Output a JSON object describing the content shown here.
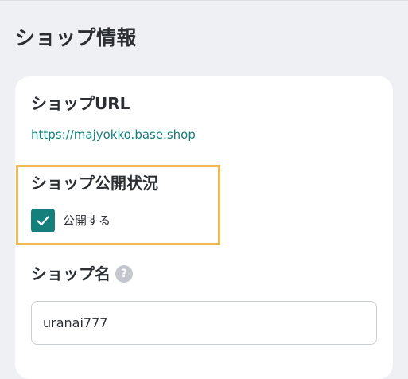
{
  "page": {
    "title": "ショップ情報"
  },
  "shop_url": {
    "label": "ショップURL",
    "value": "https://majyokko.base.shop"
  },
  "publish_status": {
    "label": "ショップ公開状況",
    "checkbox_label": "公開する",
    "checked": true
  },
  "shop_name": {
    "label": "ショップ名",
    "help_icon": "question-circle-icon",
    "help_glyph": "?",
    "value": "uranai777"
  },
  "colors": {
    "accent": "#157f7c",
    "highlight": "#f1b955",
    "background": "#eef0f3",
    "card": "#ffffff"
  }
}
